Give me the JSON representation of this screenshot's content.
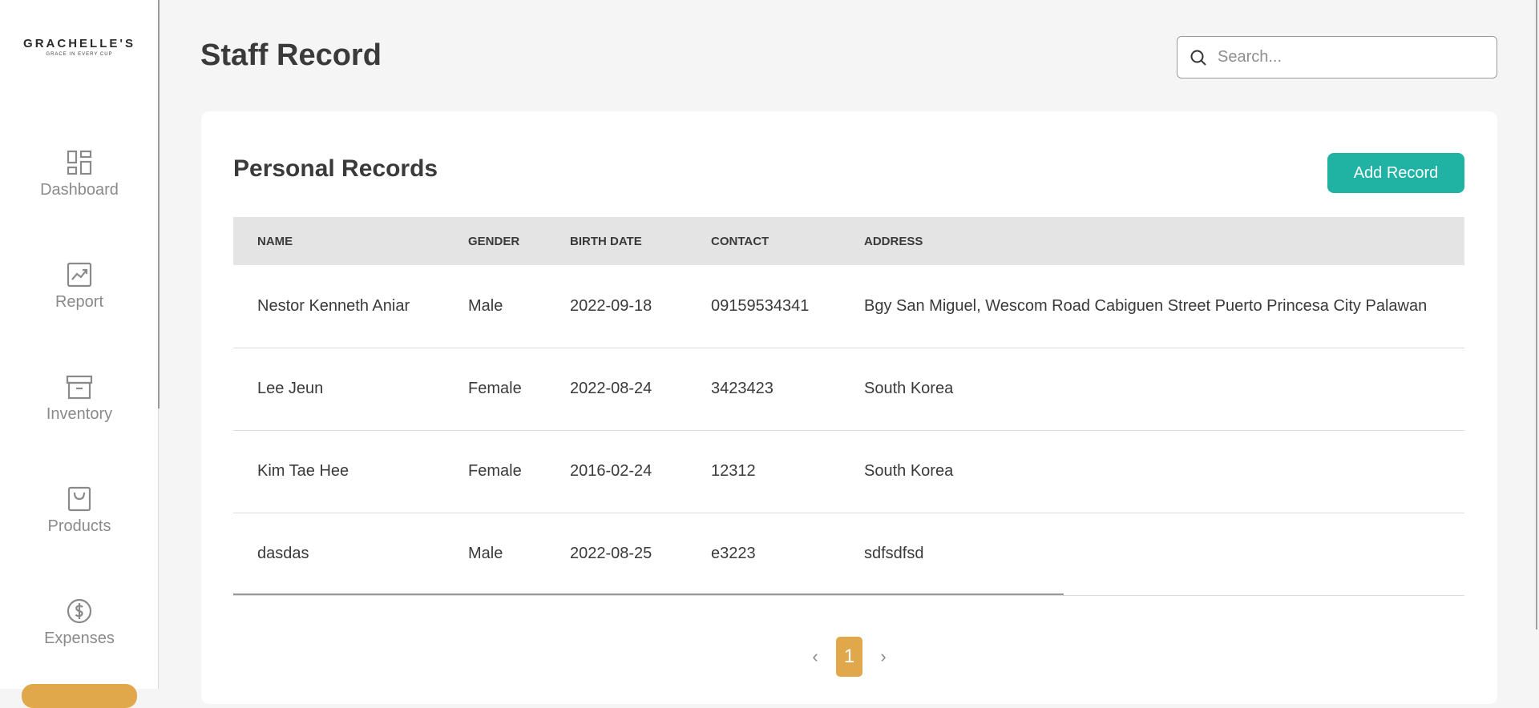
{
  "brand": {
    "name": "GRACHELLE'S",
    "tagline": "GRACE IN EVERY CUP"
  },
  "sidebar": {
    "items": [
      {
        "label": "Dashboard",
        "icon": "dashboard-icon"
      },
      {
        "label": "Report",
        "icon": "report-chart-icon"
      },
      {
        "label": "Inventory",
        "icon": "archive-box-icon"
      },
      {
        "label": "Products",
        "icon": "shopping-bag-icon"
      },
      {
        "label": "Expenses",
        "icon": "dollar-circle-icon"
      }
    ]
  },
  "header": {
    "title": "Staff Record",
    "search_placeholder": "Search...",
    "search_value": ""
  },
  "card": {
    "title": "Personal Records",
    "add_button": "Add Record"
  },
  "table": {
    "columns": [
      "Name",
      "Gender",
      "Birth Date",
      "Contact",
      "Address"
    ],
    "rows": [
      [
        "Nestor Kenneth Aniar",
        "Male",
        "2022-09-18",
        "09159534341",
        "Bgy San Miguel, Wescom Road Cabiguen Street Puerto Princesa City Palawan"
      ],
      [
        "Lee Jeun",
        "Female",
        "2022-08-24",
        "3423423",
        "South Korea"
      ],
      [
        "Kim Tae Hee",
        "Female",
        "2016-02-24",
        "12312",
        "South Korea"
      ],
      [
        "dasdas",
        "Male",
        "2022-08-25",
        "e3223",
        "sdfsdfsd"
      ]
    ]
  },
  "pagination": {
    "prev": "‹",
    "current": "1",
    "next": "›"
  },
  "colors": {
    "accent_teal": "#20b2a3",
    "accent_gold": "#e0a84a",
    "background": "#f5f5f5"
  }
}
